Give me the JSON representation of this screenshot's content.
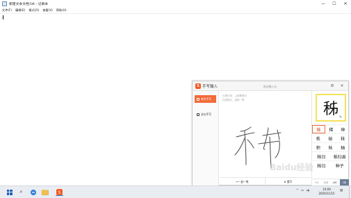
{
  "window": {
    "title": "新建文本文档.txt - 记事本",
    "controls": {
      "minimize": "—",
      "maximize": "☐",
      "close": "✕"
    }
  },
  "menu": {
    "items": [
      {
        "label": "文件(F)"
      },
      {
        "label": "编辑(E)"
      },
      {
        "label": "格式(O)"
      },
      {
        "label": "查看(V)"
      },
      {
        "label": "帮助(H)"
      }
    ]
  },
  "handwriting": {
    "logo": "S",
    "title": "手写输入",
    "drag_hint": "拖动输入法",
    "settings_icon": "⚙",
    "close_icon": "✕",
    "modes": [
      {
        "label": "单字手写",
        "active": true
      },
      {
        "label": "长句手写",
        "active": false
      }
    ],
    "hints": [
      "已提示您：上部是提示",
      "在线提示，选择一笔"
    ],
    "footer": {
      "undo": "退一笔",
      "rewrite": "重写"
    },
    "preview_char": "秭",
    "preview_edit_icon": "✎",
    "candidates": [
      [
        "秭",
        "稀",
        "种"
      ],
      [
        "秩",
        "秘",
        "秣"
      ],
      [
        "积",
        "秋",
        "秞"
      ],
      [
        "秭归",
        "秭归县"
      ],
      [
        "秭归",
        "种子"
      ]
    ],
    "selected_candidate": "秭",
    "bottom_keys": [
      "+1",
      "123",
      "ABC",
      "⌫"
    ],
    "accent_color": "#f26b3a"
  },
  "taskbar": {
    "search_icon": "⌕",
    "tray_up_icon": "^",
    "ime_label": "中",
    "time": "10:09",
    "date": "2020/11/15"
  },
  "watermark": "Baidu经验"
}
